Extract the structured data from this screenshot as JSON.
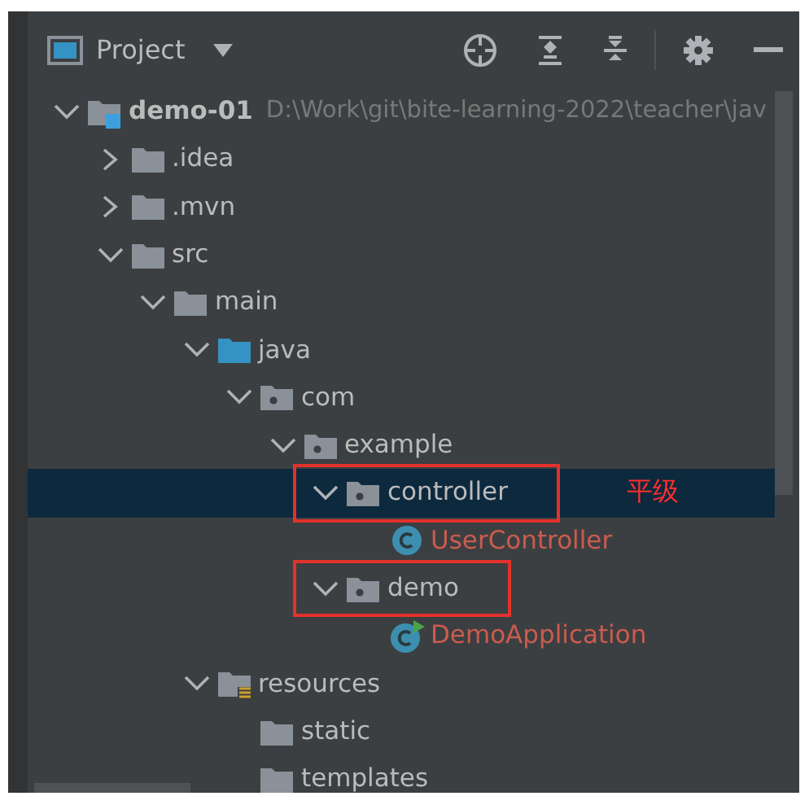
{
  "panel": {
    "title": "Project"
  },
  "tree": [
    {
      "label": "demo-01",
      "kind": "module",
      "detail": "D:\\Work\\git\\bite-learning-2022\\teacher\\jav",
      "expanded": true,
      "selected": false,
      "children": [
        {
          "label": ".idea",
          "kind": "folder",
          "expanded": false,
          "selected": false
        },
        {
          "label": ".mvn",
          "kind": "folder",
          "expanded": false,
          "selected": false
        },
        {
          "label": "src",
          "kind": "folder",
          "expanded": true,
          "selected": false,
          "children": [
            {
              "label": "main",
              "kind": "folder",
              "expanded": true,
              "selected": false,
              "children": [
                {
                  "label": "java",
                  "kind": "source",
                  "expanded": true,
                  "selected": false,
                  "children": [
                    {
                      "label": "com",
                      "kind": "package",
                      "expanded": true,
                      "selected": false,
                      "children": [
                        {
                          "label": "example",
                          "kind": "package",
                          "expanded": true,
                          "selected": false,
                          "children": [
                            {
                              "label": "controller",
                              "kind": "package",
                              "expanded": true,
                              "selected": true,
                              "outlined": true,
                              "note": "平级",
                              "children": [
                                {
                                  "label": "UserController",
                                  "kind": "class",
                                  "selected": false
                                }
                              ]
                            },
                            {
                              "label": "demo",
                              "kind": "package",
                              "expanded": true,
                              "selected": false,
                              "outlined": true,
                              "children": [
                                {
                                  "label": "DemoApplication",
                                  "kind": "app",
                                  "selected": false
                                }
                              ]
                            }
                          ]
                        }
                      ]
                    }
                  ]
                },
                {
                  "label": "resources",
                  "kind": "resources",
                  "expanded": true,
                  "selected": false,
                  "children": [
                    {
                      "label": "static",
                      "kind": "folder",
                      "selected": false
                    },
                    {
                      "label": "templates",
                      "kind": "folder",
                      "selected": false
                    }
                  ]
                }
              ]
            }
          ]
        }
      ]
    }
  ]
}
